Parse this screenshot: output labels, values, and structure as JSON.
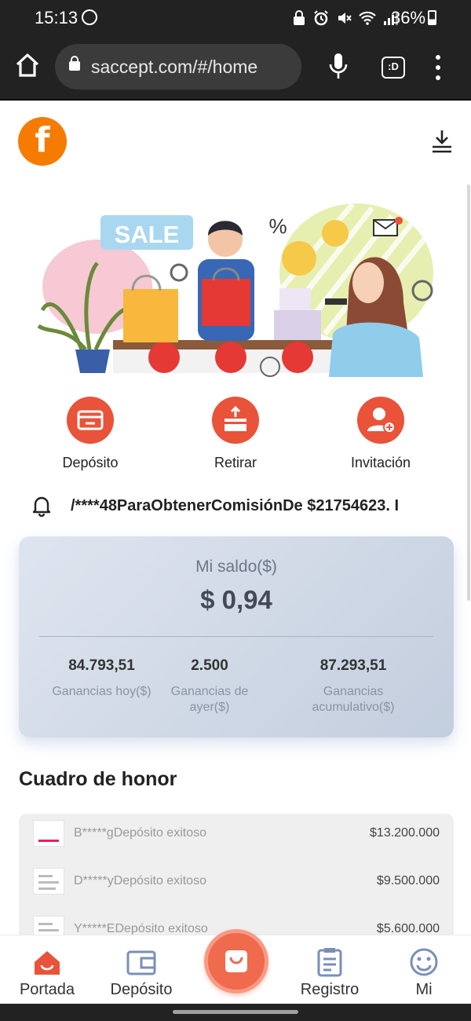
{
  "status_bar": {
    "time": "15:13",
    "battery": "36%",
    "icons": [
      "whatsapp-icon",
      "lock-icon",
      "alarm-icon",
      "mute-icon",
      "wifi-icon",
      "signal-icon",
      "battery-icon"
    ]
  },
  "browser": {
    "url": "saccept.com/#/home",
    "tabs_label": ":D"
  },
  "app": {
    "logo_letter": "f",
    "accent_color": "#e8533a",
    "logo_color": "#f57c00"
  },
  "banner": {
    "sale_text": "SALE",
    "percent_text": "%"
  },
  "actions": [
    {
      "label": "Depósito",
      "icon": "card-icon"
    },
    {
      "label": "Retirar",
      "icon": "withdraw-box-icon"
    },
    {
      "label": "Invitación",
      "icon": "add-user-icon"
    }
  ],
  "notice": {
    "text": "/****48ParaObtenerComisiónDe $21754623. I"
  },
  "balance": {
    "title": "Mi saldo($)",
    "amount": "$ 0,94",
    "stats": [
      {
        "value": "84.793,51",
        "label": "Ganancias hoy($)"
      },
      {
        "value": "2.500",
        "label": "Ganancias de ayer($)"
      },
      {
        "value": "87.293,51",
        "label": "Ganancias acumulativo($)"
      }
    ]
  },
  "honor": {
    "title": "Cuadro de honor",
    "rows": [
      {
        "name": "B*****gDepósito exitoso",
        "amount": "$13.200.000"
      },
      {
        "name": "D*****yDepósito exitoso",
        "amount": "$9.500.000"
      },
      {
        "name": "Y*****EDepósito exitoso",
        "amount": "$5.600.000"
      }
    ]
  },
  "bottom_nav": [
    {
      "label": "Portada",
      "icon": "home-icon",
      "active": true
    },
    {
      "label": "Depósito",
      "icon": "wallet-icon",
      "active": false
    },
    {
      "label": "",
      "icon": "shopping-bag-icon",
      "active": false
    },
    {
      "label": "Registro",
      "icon": "clipboard-icon",
      "active": false
    },
    {
      "label": "Mi",
      "icon": "smiley-icon",
      "active": false
    }
  ]
}
